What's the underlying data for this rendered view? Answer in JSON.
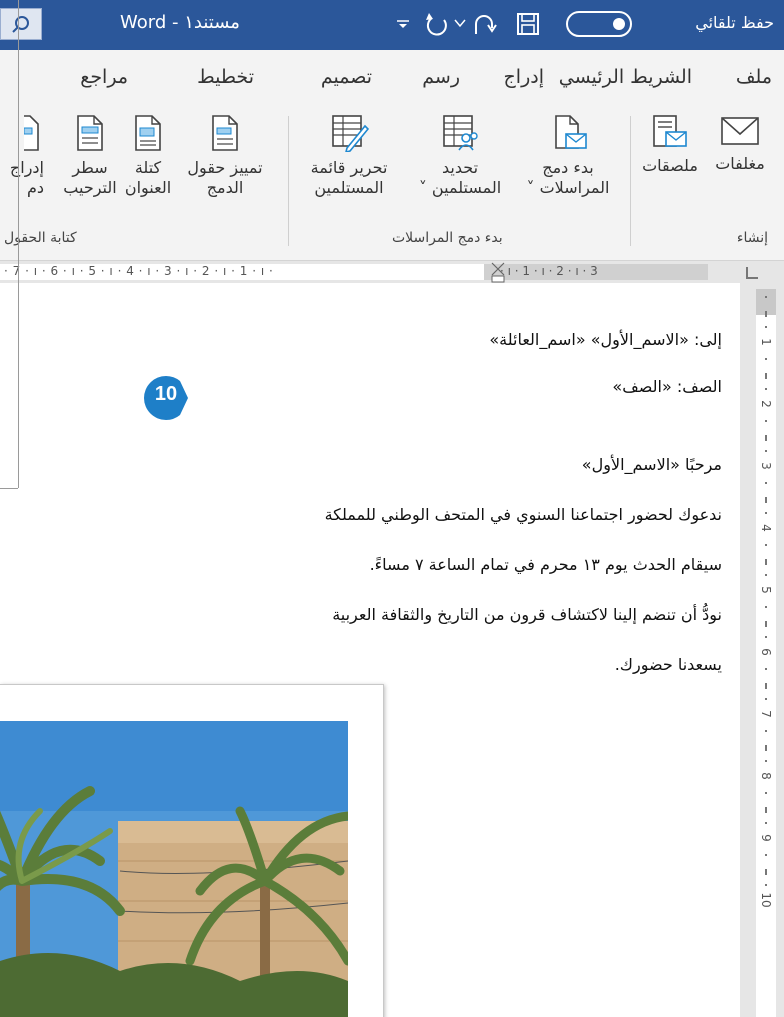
{
  "titlebar": {
    "autosave": "حفظ تلقائي",
    "doc_title": "مستند١ - Word",
    "search_icon": "search-icon",
    "save_icon": "save-icon",
    "undo_icon": "undo-icon",
    "redo_icon": "redo-icon",
    "customize_icon": "customize-arrow-icon"
  },
  "tabs": [
    "ملف",
    "الشريط الرئيسي",
    "إدراج",
    "رسم",
    "تصميم",
    "تخطيط",
    "مراجع"
  ],
  "ribbon": {
    "create_group": {
      "label": "إنشاء",
      "envelopes": "مغلفات",
      "labels": "ملصقات"
    },
    "mailmerge_group": {
      "label": "بدء دمج المراسلات",
      "start_line1": "بدء دمج",
      "start_line2": "المراسلات ˅",
      "select_line1": "تحديد",
      "select_line2": "المستلمين ˅",
      "edit_line1": "تحرير قائمة",
      "edit_line2": "المستلمين"
    },
    "fields_group": {
      "label": "كتابة الحقول",
      "highlight_line1": "تمييز حقول",
      "highlight_line2": "الدمج",
      "address_line1": "كتلة",
      "address_line2": "العنوان",
      "greeting_line1": "سطر",
      "greeting_line2": "الترحيب",
      "insert_line1": "إدراج",
      "insert_line2": "دم"
    }
  },
  "ruler": {
    "left_marks": "· 7 · ı · 6 · ı · 5 · ı · 4 · ı · 3 · ı · 2 · ı · 1 · ı ·",
    "right_marks": "· ı · 1 · ı · 2 · ı · 3"
  },
  "document": {
    "line1": "إلى: «الاسم_الأول» «اسم_العائلة»",
    "line2": "الصف: «الصف»",
    "line3": "مرحبًا «الاسم_الأول»",
    "line4": "ندعوك لحضور اجتماعنا السنوي في المتحف الوطني للمملكة",
    "line5": "سيقام الحدث يوم ١٣ محرم في تمام الساعة ٧ مساءً.",
    "line6": "نودُّ أن تنضم إلينا لاكتشاف قرون من التاريخ والثقافة العربية",
    "line7": "يسعدنا حضورك."
  },
  "step_badge": "10",
  "vruler_marks": [
    "1",
    "2",
    "3",
    "4",
    "5",
    "6",
    "7",
    "8",
    "9",
    "10"
  ]
}
